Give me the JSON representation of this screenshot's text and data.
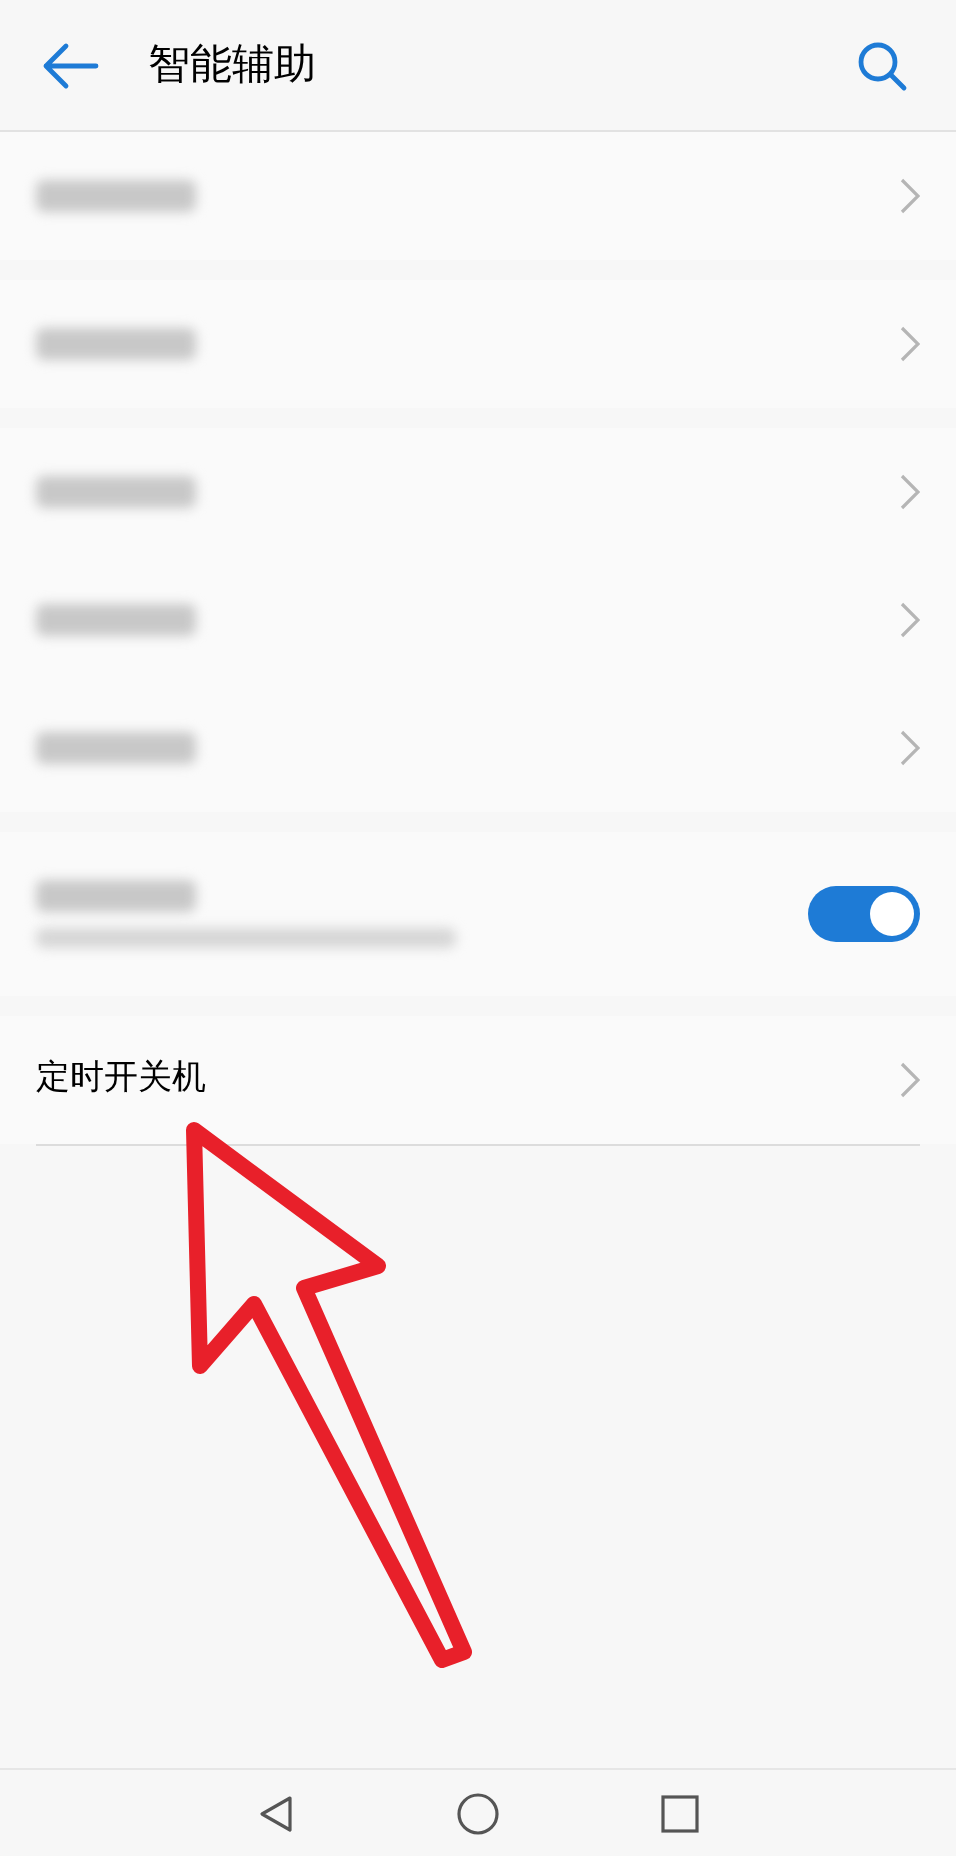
{
  "header": {
    "title": "智能辅助"
  },
  "groups": [
    {
      "rows": [
        {
          "kind": "link",
          "blurred": true
        }
      ]
    },
    {
      "rows": [
        {
          "kind": "link",
          "blurred": true
        }
      ]
    },
    {
      "rows": [
        {
          "kind": "link",
          "blurred": true
        },
        {
          "kind": "link",
          "blurred": true
        },
        {
          "kind": "link",
          "blurred": true
        }
      ]
    },
    {
      "rows": [
        {
          "kind": "toggle",
          "blurred": true,
          "on": true
        }
      ]
    },
    {
      "rows": [
        {
          "kind": "link",
          "blurred": false,
          "label": "定时开关机"
        }
      ]
    }
  ],
  "annotation": {
    "kind": "arrow"
  }
}
